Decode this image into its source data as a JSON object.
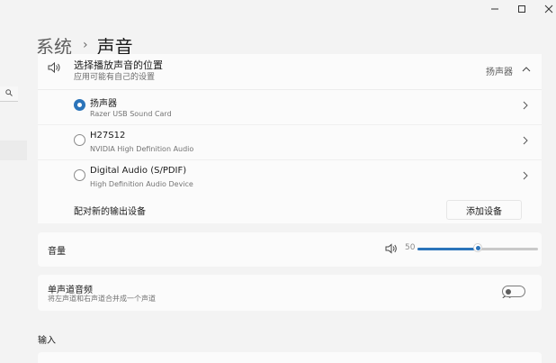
{
  "window": {
    "minimize_label": "–",
    "maximize_label": "□",
    "close_label": "×"
  },
  "breadcrumb": {
    "parent": "系统",
    "separator": "›",
    "current": "声音"
  },
  "output_location": {
    "title": "选择播放声音的位置",
    "subtitle": "应用可能有自己的设置",
    "value": "扬声器"
  },
  "devices": [
    {
      "name": "扬声器",
      "detail": "Razer USB Sound Card",
      "selected": true
    },
    {
      "name": "H27S12",
      "detail": "NVIDIA High Definition Audio",
      "selected": false
    },
    {
      "name": "Digital Audio (S/PDIF)",
      "detail": "High Definition Audio Device",
      "selected": false
    }
  ],
  "pair": {
    "label": "配对新的输出设备",
    "button": "添加设备"
  },
  "volume": {
    "label": "音量",
    "value": "50",
    "fraction": 0.5
  },
  "mono": {
    "label": "单声道音频",
    "subtitle": "将左声道和右声道合并成一个声道",
    "state": "关"
  },
  "input_section": {
    "label": "输入"
  },
  "colors": {
    "accent": "#2b74ba"
  }
}
